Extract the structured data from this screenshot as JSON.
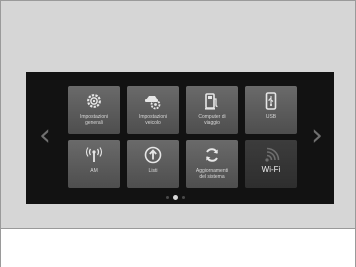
{
  "nav": {
    "prev_glyph": "‹",
    "next_glyph": "›"
  },
  "tiles": [
    {
      "label": "Impostazioni\ngenerali",
      "icon": "gear-icon"
    },
    {
      "label": "Impostazioni\nveicolo",
      "icon": "car-settings-icon"
    },
    {
      "label": "Computer di\nviaggio",
      "icon": "fuel-computer-icon"
    },
    {
      "label": "USB",
      "icon": "usb-icon"
    },
    {
      "label": "AM",
      "icon": "radio-antenna-icon"
    },
    {
      "label": "Listi",
      "icon": "upload-icon"
    },
    {
      "label": "Aggiornamenti\ndel sistema",
      "icon": "refresh-icon"
    },
    {
      "label": "Wi-Fi",
      "icon": "wifi-icon"
    }
  ],
  "pager": {
    "pages": 3,
    "active": 2
  },
  "colors": {
    "screen": "#121212",
    "tile": "#5a5a5a",
    "icon": "#e6e6e6"
  }
}
